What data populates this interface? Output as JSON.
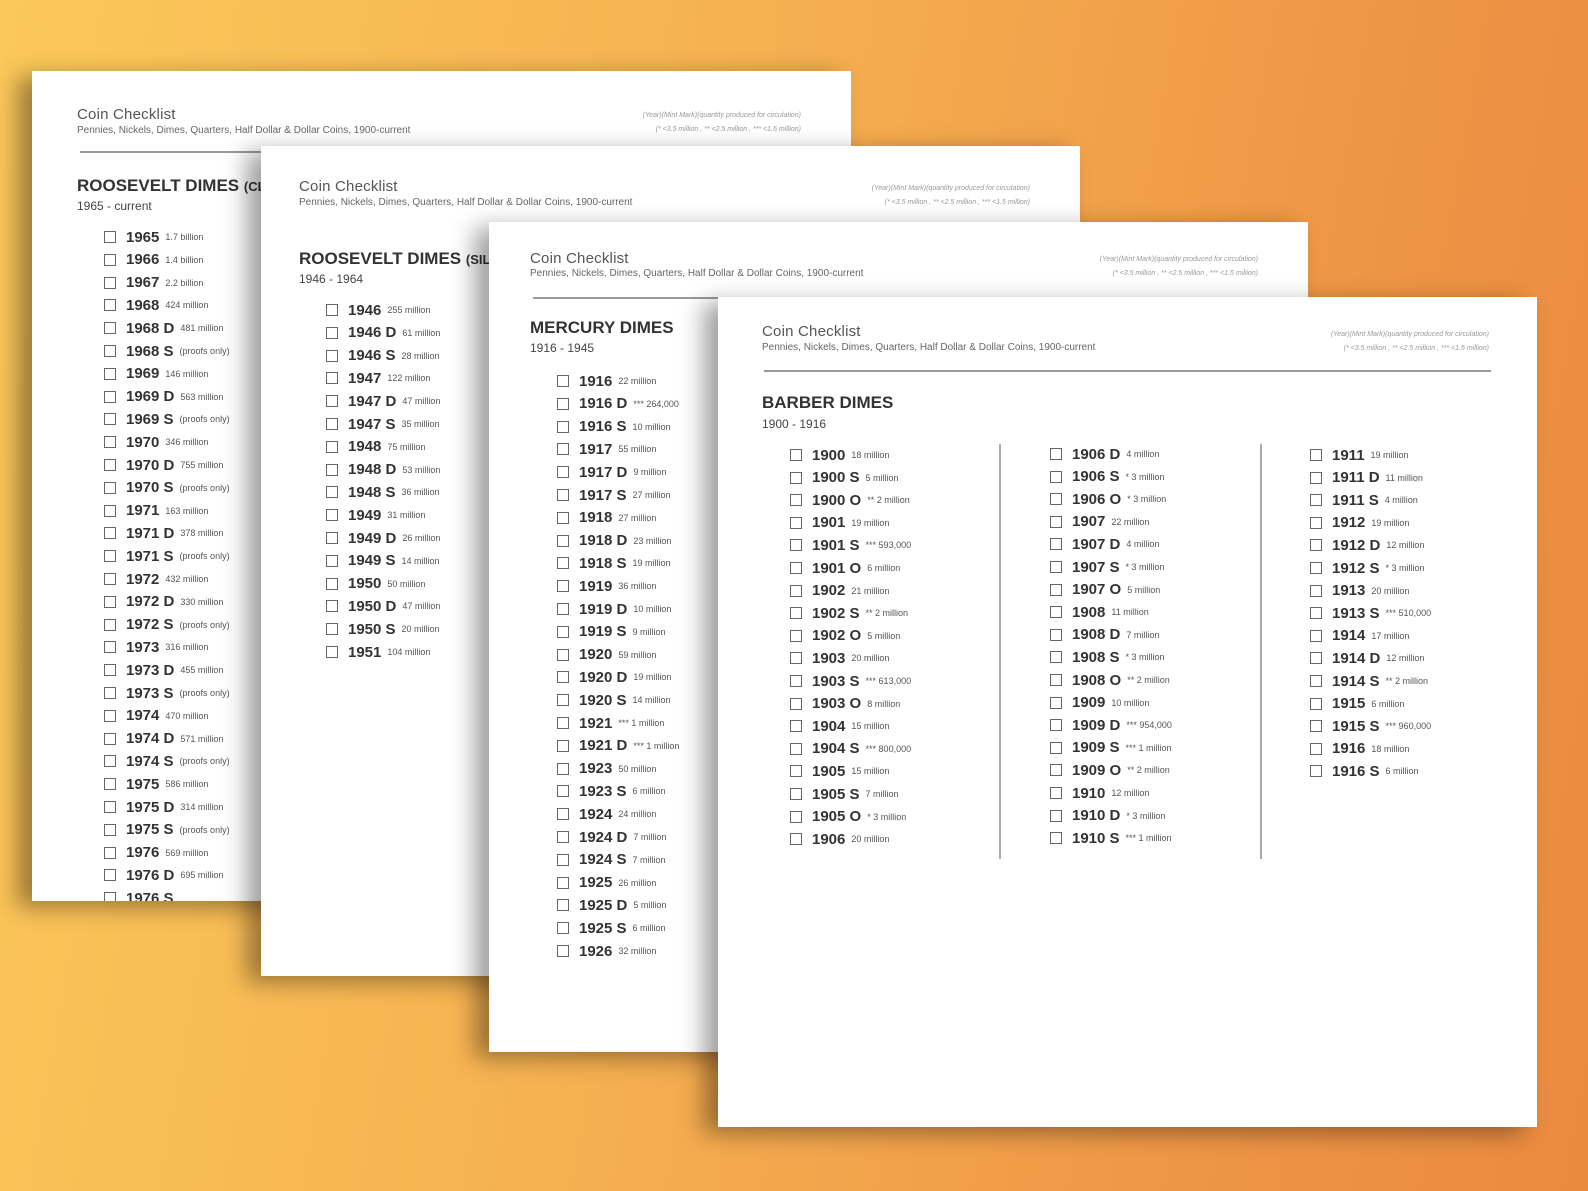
{
  "header": {
    "title": "Coin Checklist",
    "subtitle": "Pennies, Nickels, Dimes, Quarters, Half Dollar & Dollar Coins, 1900-current",
    "legend_line1": "(Year)(Mint Mark)(quantity produced for circulation)",
    "legend_line2": "(* <3.5 million , ** <2.5 million , *** <1.5 million)"
  },
  "sheets": [
    {
      "title": "ROOSEVELT DIMES",
      "title_suffix": "(CLA",
      "range": "1965 - current",
      "items": [
        {
          "year": "1965",
          "qty": "1.7 billion"
        },
        {
          "year": "1966",
          "qty": "1.4 billion"
        },
        {
          "year": "1967",
          "qty": "2.2 billion"
        },
        {
          "year": "1968",
          "qty": "424 million"
        },
        {
          "year": "1968 D",
          "qty": "481 million"
        },
        {
          "year": "1968 S",
          "qty": "(proofs only)"
        },
        {
          "year": "1969",
          "qty": "146 million"
        },
        {
          "year": "1969 D",
          "qty": "563 million"
        },
        {
          "year": "1969 S",
          "qty": "(proofs only)"
        },
        {
          "year": "1970",
          "qty": "346 million"
        },
        {
          "year": "1970 D",
          "qty": "755 million"
        },
        {
          "year": "1970 S",
          "qty": "(proofs only)"
        },
        {
          "year": "1971",
          "qty": "163 million"
        },
        {
          "year": "1971 D",
          "qty": "378 million"
        },
        {
          "year": "1971 S",
          "qty": "(proofs only)"
        },
        {
          "year": "1972",
          "qty": "432 million"
        },
        {
          "year": "1972 D",
          "qty": "330 million"
        },
        {
          "year": "1972 S",
          "qty": "(proofs only)"
        },
        {
          "year": "1973",
          "qty": "316 million"
        },
        {
          "year": "1973 D",
          "qty": "455 million"
        },
        {
          "year": "1973 S",
          "qty": "(proofs only)"
        },
        {
          "year": "1974",
          "qty": "470 million"
        },
        {
          "year": "1974 D",
          "qty": "571 million"
        },
        {
          "year": "1974 S",
          "qty": "(proofs only)"
        },
        {
          "year": "1975",
          "qty": "586 million"
        },
        {
          "year": "1975 D",
          "qty": "314 million"
        },
        {
          "year": "1975 S",
          "qty": "(proofs only)"
        },
        {
          "year": "1976",
          "qty": "569 million"
        },
        {
          "year": "1976 D",
          "qty": "695 million"
        },
        {
          "year": "1976 S",
          "qty": ""
        }
      ]
    },
    {
      "title": "ROOSEVELT DIMES",
      "title_suffix": "(SILV",
      "range": "1946 - 1964",
      "items": [
        {
          "year": "1946",
          "qty": "255 million"
        },
        {
          "year": "1946 D",
          "qty": "61 million"
        },
        {
          "year": "1946 S",
          "qty": "28 million"
        },
        {
          "year": "1947",
          "qty": "122 million"
        },
        {
          "year": "1947 D",
          "qty": "47 million"
        },
        {
          "year": "1947 S",
          "qty": "35 million"
        },
        {
          "year": "1948",
          "qty": "75 million"
        },
        {
          "year": "1948 D",
          "qty": "53 million"
        },
        {
          "year": "1948 S",
          "qty": "36 million"
        },
        {
          "year": "1949",
          "qty": "31 million"
        },
        {
          "year": "1949 D",
          "qty": "26 million"
        },
        {
          "year": "1949 S",
          "qty": "14 million"
        },
        {
          "year": "1950",
          "qty": "50 million"
        },
        {
          "year": "1950 D",
          "qty": "47 million"
        },
        {
          "year": "1950 S",
          "qty": "20 million"
        },
        {
          "year": "1951",
          "qty": "104 million"
        }
      ]
    },
    {
      "title": "MERCURY DIMES",
      "title_suffix": "",
      "range": "1916 - 1945",
      "items": [
        {
          "year": "1916",
          "qty": "22 million"
        },
        {
          "year": "1916 D",
          "qty": "*** 264,000"
        },
        {
          "year": "1916 S",
          "qty": "10 million"
        },
        {
          "year": "1917",
          "qty": "55 million"
        },
        {
          "year": "1917 D",
          "qty": "9 million"
        },
        {
          "year": "1917 S",
          "qty": "27 million"
        },
        {
          "year": "1918",
          "qty": "27 million"
        },
        {
          "year": "1918 D",
          "qty": "23 million"
        },
        {
          "year": "1918 S",
          "qty": "19 million"
        },
        {
          "year": "1919",
          "qty": "36 million"
        },
        {
          "year": "1919 D",
          "qty": "10 million"
        },
        {
          "year": "1919 S",
          "qty": "9 million"
        },
        {
          "year": "1920",
          "qty": "59 million"
        },
        {
          "year": "1920 D",
          "qty": "19 million"
        },
        {
          "year": "1920 S",
          "qty": "14 million"
        },
        {
          "year": "1921",
          "qty": "*** 1 million"
        },
        {
          "year": "1921 D",
          "qty": "*** 1 million"
        },
        {
          "year": "1923",
          "qty": "50 million"
        },
        {
          "year": "1923 S",
          "qty": "6 million"
        },
        {
          "year": "1924",
          "qty": "24 million"
        },
        {
          "year": "1924 D",
          "qty": "7 million"
        },
        {
          "year": "1924 S",
          "qty": "7 million"
        },
        {
          "year": "1925",
          "qty": "26 million"
        },
        {
          "year": "1925 D",
          "qty": "5 million"
        },
        {
          "year": "1925 S",
          "qty": "6 million"
        },
        {
          "year": "1926",
          "qty": "32 million"
        }
      ]
    },
    {
      "title": "BARBER DIMES",
      "title_suffix": "",
      "range": "1900 - 1916",
      "columns": [
        [
          {
            "year": "1900",
            "qty": "18 million"
          },
          {
            "year": "1900 S",
            "qty": "5 million"
          },
          {
            "year": "1900 O",
            "qty": "** 2 million"
          },
          {
            "year": "1901",
            "qty": "19 million"
          },
          {
            "year": "1901 S",
            "qty": "*** 593,000"
          },
          {
            "year": "1901 O",
            "qty": "6 million"
          },
          {
            "year": "1902",
            "qty": "21 million"
          },
          {
            "year": "1902 S",
            "qty": "** 2 million"
          },
          {
            "year": "1902 O",
            "qty": "5 million"
          },
          {
            "year": "1903",
            "qty": "20 million"
          },
          {
            "year": "1903 S",
            "qty": "*** 613,000"
          },
          {
            "year": "1903 O",
            "qty": "8 million"
          },
          {
            "year": "1904",
            "qty": "15 million"
          },
          {
            "year": "1904 S",
            "qty": "*** 800,000"
          },
          {
            "year": "1905",
            "qty": "15 million"
          },
          {
            "year": "1905 S",
            "qty": "7 million"
          },
          {
            "year": "1905 O",
            "qty": "* 3 million"
          },
          {
            "year": "1906",
            "qty": "20 million"
          }
        ],
        [
          {
            "year": "1906 D",
            "qty": "4 million"
          },
          {
            "year": "1906 S",
            "qty": "* 3 million"
          },
          {
            "year": "1906 O",
            "qty": "* 3 million"
          },
          {
            "year": "1907",
            "qty": "22 million"
          },
          {
            "year": "1907 D",
            "qty": "4 million"
          },
          {
            "year": "1907 S",
            "qty": "* 3 million"
          },
          {
            "year": "1907 O",
            "qty": "5 million"
          },
          {
            "year": "1908",
            "qty": "11 million"
          },
          {
            "year": "1908 D",
            "qty": "7 million"
          },
          {
            "year": "1908 S",
            "qty": "* 3 million"
          },
          {
            "year": "1908 O",
            "qty": "** 2 million"
          },
          {
            "year": "1909",
            "qty": "10 million"
          },
          {
            "year": "1909 D",
            "qty": "*** 954,000"
          },
          {
            "year": "1909 S",
            "qty": "*** 1 million"
          },
          {
            "year": "1909 O",
            "qty": "** 2 million"
          },
          {
            "year": "1910",
            "qty": "12 million"
          },
          {
            "year": "1910 D",
            "qty": "* 3 million"
          },
          {
            "year": "1910 S",
            "qty": "*** 1 million"
          }
        ],
        [
          {
            "year": "1911",
            "qty": "19 million"
          },
          {
            "year": "1911 D",
            "qty": "11 million"
          },
          {
            "year": "1911 S",
            "qty": "4 million"
          },
          {
            "year": "1912",
            "qty": "19 million"
          },
          {
            "year": "1912 D",
            "qty": "12 million"
          },
          {
            "year": "1912 S",
            "qty": "* 3 million"
          },
          {
            "year": "1913",
            "qty": "20 million"
          },
          {
            "year": "1913 S",
            "qty": "*** 510,000"
          },
          {
            "year": "1914",
            "qty": "17 million"
          },
          {
            "year": "1914 D",
            "qty": "12 million"
          },
          {
            "year": "1914 S",
            "qty": "** 2 million"
          },
          {
            "year": "1915",
            "qty": "6 million"
          },
          {
            "year": "1915 S",
            "qty": "*** 960,000"
          },
          {
            "year": "1916",
            "qty": "18 million"
          },
          {
            "year": "1916 S",
            "qty": "6 million"
          }
        ]
      ]
    }
  ]
}
